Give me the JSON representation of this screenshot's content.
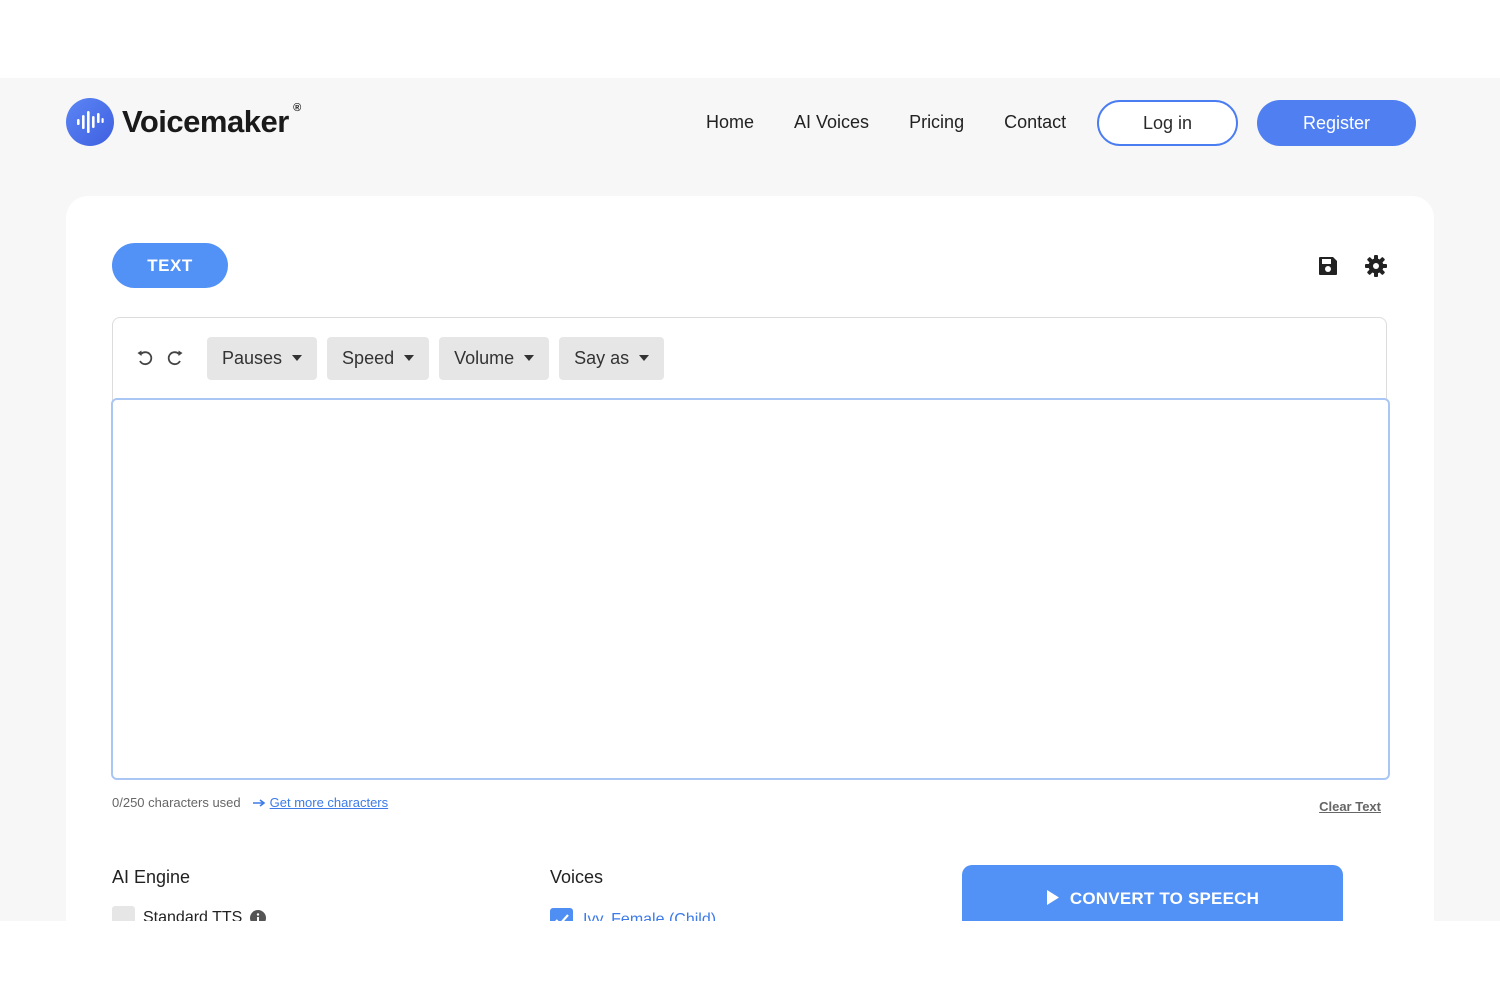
{
  "brand": {
    "name": "Voicemaker",
    "registered": "®",
    "color": "#4f7ff1"
  },
  "nav": {
    "links": [
      "Home",
      "AI Voices",
      "Pricing",
      "Contact"
    ],
    "login_label": "Log in",
    "register_label": "Register"
  },
  "toolbar": {
    "tab_label": "TEXT",
    "icons": [
      "save-icon",
      "gear-icon"
    ]
  },
  "editor": {
    "undo_icon": "undo-icon",
    "redo_icon": "redo-icon",
    "dropdowns": [
      "Pauses",
      "Speed",
      "Volume",
      "Say as"
    ],
    "text_value": "",
    "counter": "0/250 characters used",
    "more_link": "Get more characters",
    "clear_label": "Clear Text"
  },
  "engine": {
    "label": "AI Engine",
    "option": "Standard TTS",
    "checked": false
  },
  "voices": {
    "label": "Voices",
    "option": "Ivy, Female (Child)",
    "checked": true
  },
  "convert": {
    "label": "CONVERT TO SPEECH",
    "color": "#5291f5"
  }
}
